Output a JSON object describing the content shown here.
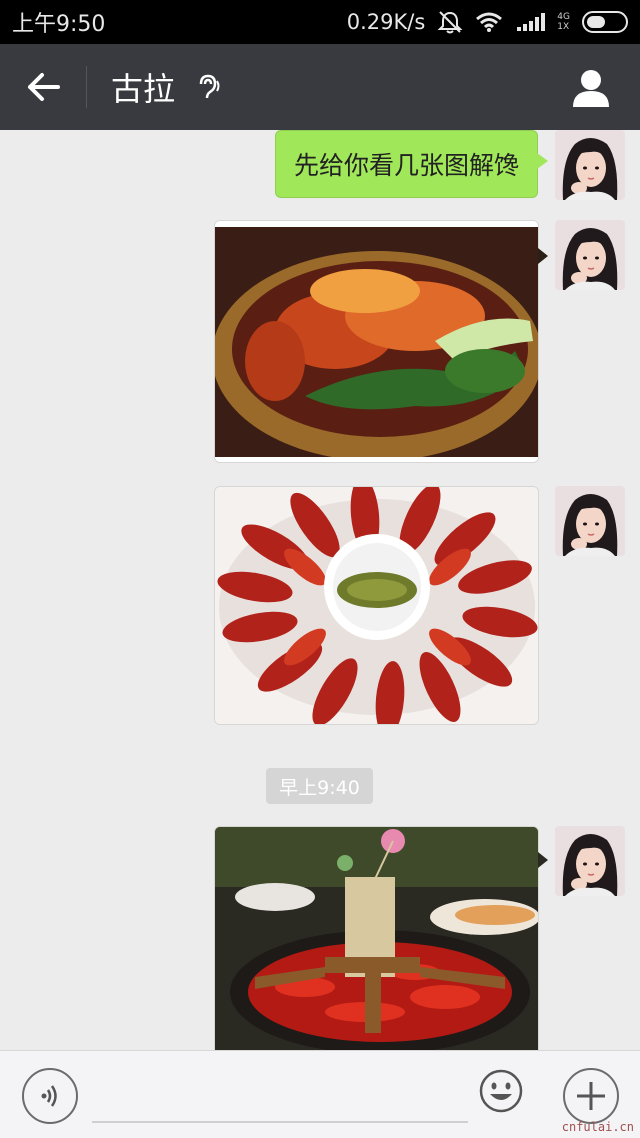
{
  "status_bar": {
    "time": "上午9:50",
    "speed": "0.29K/s",
    "network_top": "4G",
    "network_bottom": "1X"
  },
  "header": {
    "title": "古拉",
    "colors": {
      "bg": "#393a3f"
    }
  },
  "messages": [
    {
      "type": "text",
      "text": "先给你看几张图解馋"
    },
    {
      "type": "image",
      "subject": "braised food pot"
    },
    {
      "type": "image",
      "subject": "crayfish plate"
    },
    {
      "type": "timestamp",
      "text": "早上9:40"
    },
    {
      "type": "image",
      "subject": "hotpot"
    }
  ],
  "input": {
    "placeholder": ""
  },
  "icons": {
    "back": "back-arrow-icon",
    "ear": "earpiece-icon",
    "profile": "person-icon",
    "voice": "voice-icon",
    "emoji": "emoji-icon",
    "plus": "plus-icon"
  },
  "colors": {
    "bubble": "#a0e759",
    "chat_bg": "#ececec"
  },
  "watermark": "cnfulai.cn"
}
